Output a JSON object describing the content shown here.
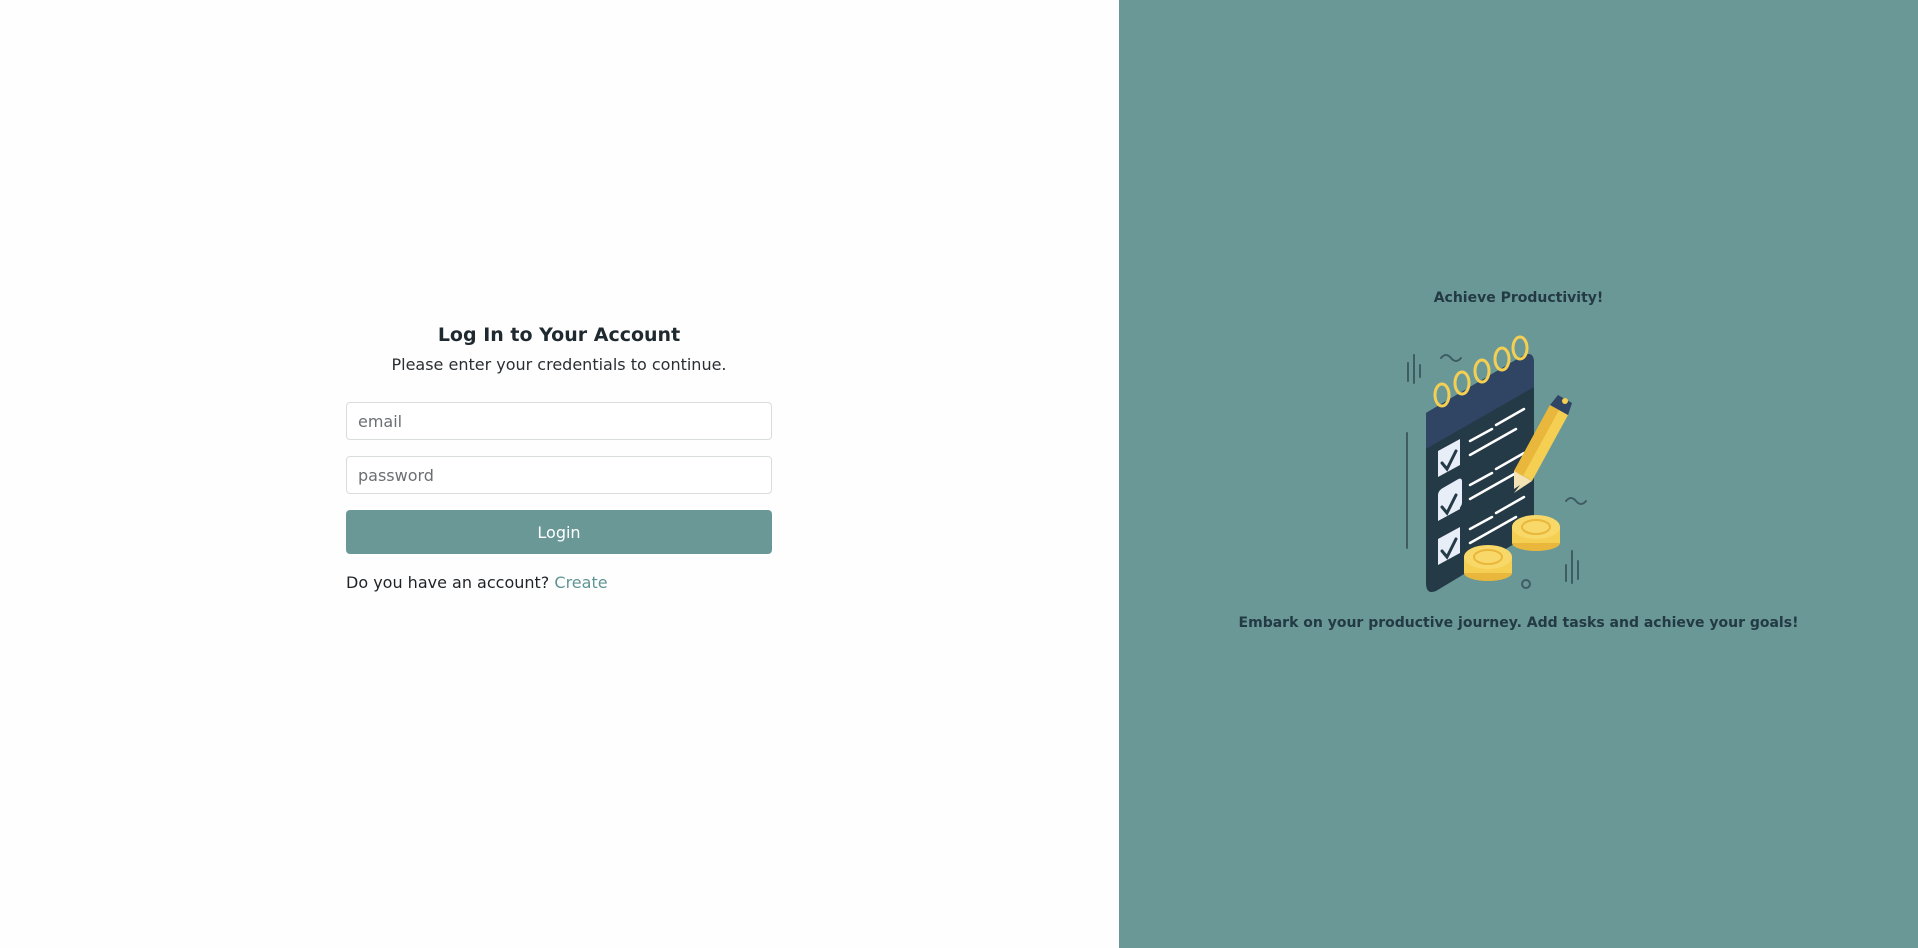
{
  "login": {
    "title": "Log In to Your Account",
    "subtitle": "Please enter your credentials to continue.",
    "email_placeholder": "email",
    "password_placeholder": "password",
    "login_label": "Login",
    "signup_prompt": "Do you have an account?",
    "signup_link": "Create"
  },
  "promo": {
    "heading": "Achieve Productivity!",
    "illustration_icon": "checklist-clipboard-icon",
    "tagline": "Embark on your productive journey. Add tasks and achieve your goals!"
  },
  "colors": {
    "accent": "#6a9897",
    "panel_bg": "#6a9897",
    "heading_text": "#233a44",
    "link": "#5f9594"
  }
}
